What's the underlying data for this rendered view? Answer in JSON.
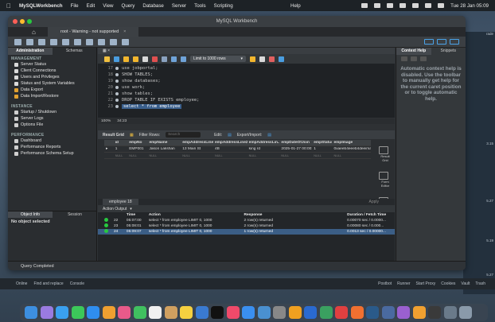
{
  "menubar": {
    "app": "MySQLWorkbench",
    "items": [
      "File",
      "Edit",
      "View",
      "Query",
      "Database",
      "Server",
      "Tools",
      "Scripting"
    ],
    "help": "Help",
    "clock": "Tue 28 Jan 05:09"
  },
  "window": {
    "title": "MySQL Workbench"
  },
  "connection_tab": {
    "label": "root - Warning - not supported"
  },
  "sidebar": {
    "tabs": [
      "Administration",
      "Schemas"
    ],
    "management_label": "MANAGEMENT",
    "management": [
      {
        "label": "Server Status",
        "color": "#d9d9d9"
      },
      {
        "label": "Client Connections",
        "color": "#d9d9d9"
      },
      {
        "label": "Users and Privileges",
        "color": "#d9d9d9"
      },
      {
        "label": "Status and System Variables",
        "color": "#d9d9d9"
      },
      {
        "label": "Data Export",
        "color": "#e0a030"
      },
      {
        "label": "Data Import/Restore",
        "color": "#e0a030"
      }
    ],
    "instance_label": "INSTANCE",
    "instance": [
      {
        "label": "Startup / Shutdown",
        "color": "#cfcfcf"
      },
      {
        "label": "Server Logs",
        "color": "#cfcfcf"
      },
      {
        "label": "Options File",
        "color": "#cfcfcf"
      }
    ],
    "performance_label": "PERFORMANCE",
    "performance": [
      {
        "label": "Dashboard",
        "color": "#cfcfcf"
      },
      {
        "label": "Performance Reports",
        "color": "#cfcfcf"
      },
      {
        "label": "Performance Schema Setup",
        "color": "#cfcfcf"
      }
    ],
    "object_tabs": [
      "Object Info",
      "Session"
    ],
    "no_object": "No object selected"
  },
  "editor": {
    "limit_label": "Limit to 1000 rows",
    "lines": [
      {
        "n": "17",
        "text": "use jobportal;"
      },
      {
        "n": "18",
        "text": "SHOW TABLES;"
      },
      {
        "n": "19",
        "text": "show databases;"
      },
      {
        "n": "20",
        "text": "use work;"
      },
      {
        "n": "21",
        "text": "show tables;"
      },
      {
        "n": "22",
        "text": "DROP TABLE IF EXISTS employee;"
      },
      {
        "n": "23",
        "text": "select * from employee"
      }
    ],
    "zoom": "100%",
    "cursor": "34:23"
  },
  "results": {
    "label": "Result Grid",
    "filter_label": "Filter Rows:",
    "search_placeholder": "Search",
    "edit_label": "Edit:",
    "export_label": "Export/Import:",
    "columns": [
      "id",
      "empNo",
      "empName",
      "empAddressLine1",
      "empAddressLine2",
      "empAddressLin...",
      "empDateOfJoin",
      "empStatus",
      "empImage"
    ],
    "row": [
      "1",
      "EMP001",
      "Jason Lakshan",
      "13 Main St",
      "4B",
      "king rd",
      "2025-01-27 00:00:00",
      "1",
      "0xaeeb4eeeb4deeimagehere"
    ],
    "null_row": [
      "NULL",
      "NULL",
      "NULL",
      "NULL",
      "NULL",
      "NULL",
      "NULL",
      "NULL",
      "NULL"
    ],
    "side_buttons": [
      "Result Grid",
      "Form Editor",
      "Field Types"
    ],
    "tab": "employee 18",
    "apply": "Apply"
  },
  "output": {
    "label": "Action Output",
    "headers": [
      "",
      "",
      "Time",
      "Action",
      "Response",
      "Duration / Fetch Time"
    ],
    "rows": [
      {
        "n": "22",
        "time": "05:07:00",
        "action": "select * from employee LIMIT 0, 1000",
        "response": "2 row(s) returned",
        "duration": "0.00070 sec / 0.0000..."
      },
      {
        "n": "23",
        "time": "05:08:01",
        "action": "select * from employee LIMIT 0, 1000",
        "response": "2 row(s) returned",
        "duration": "0.00080 sec / 0.000..."
      },
      {
        "n": "24",
        "time": "05:09:07",
        "action": "select * from employee LIMIT 0, 1000",
        "response": "1 row(s) returned",
        "duration": "0.0013 sec / 0.00000..."
      }
    ]
  },
  "context": {
    "tabs": [
      "Context Help",
      "Snippets"
    ],
    "message": "Automatic context help is disabled. Use the toolbar to manually get help for the current caret position or to toggle automatic help."
  },
  "status": "Query Completed",
  "ide_strip": {
    "left": [
      "Online",
      "Find and replace",
      "Console"
    ],
    "right": [
      "Postbot",
      "Runner",
      "Start Proxy",
      "Cookies",
      "Vault",
      "Trash"
    ]
  },
  "desktop_edge": [
    "rade",
    "3.15",
    "5.27",
    "5.19",
    "5.27"
  ]
}
